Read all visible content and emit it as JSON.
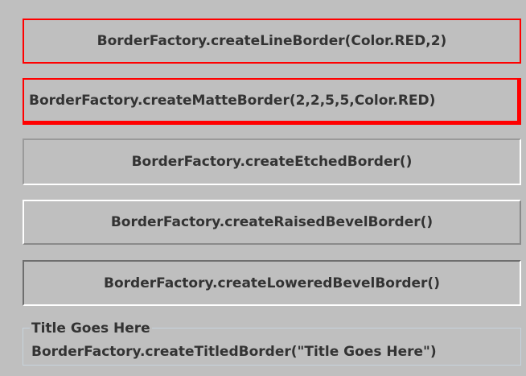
{
  "panels": {
    "line": "BorderFactory.createLineBorder(Color.RED,2)",
    "matte": "BorderFactory.createMatteBorder(2,2,5,5,Color.RED)",
    "etched": "BorderFactory.createEtchedBorder()",
    "raised": "BorderFactory.createRaisedBevelBorder()",
    "lowered": "BorderFactory.createLoweredBevelBorder()",
    "titled": {
      "title": "Title Goes Here",
      "text": "BorderFactory.createTitledBorder(\"Title Goes Here\")"
    }
  },
  "colors": {
    "background": "#bfbfbf",
    "accent_red": "#ff0000",
    "text": "#333333",
    "titled_border": "#c7d3dd"
  }
}
